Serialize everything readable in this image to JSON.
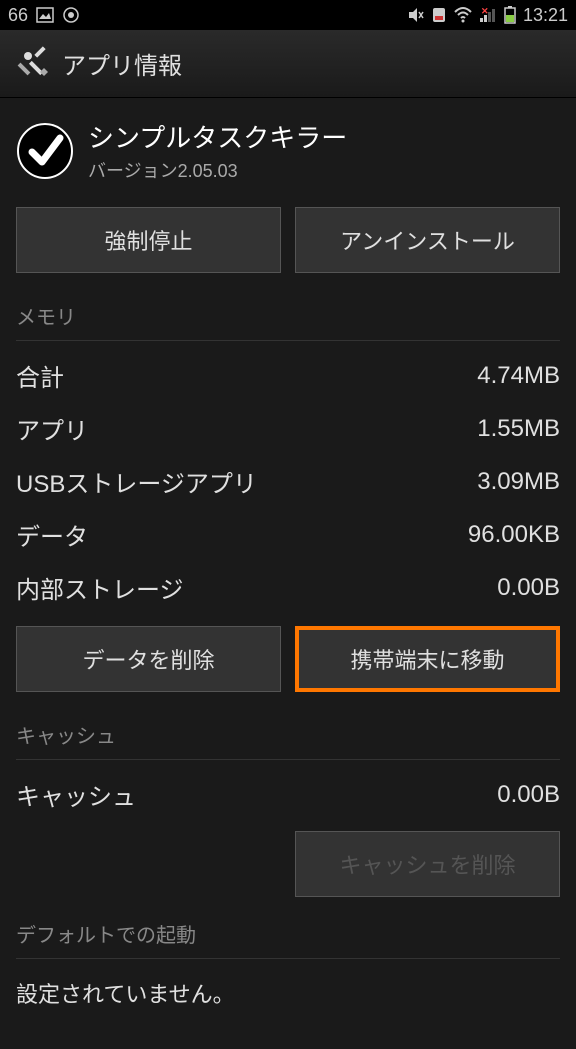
{
  "status_bar": {
    "left_number": "66",
    "time": "13:21"
  },
  "header": {
    "title": "アプリ情報"
  },
  "app": {
    "name": "シンプルタスクキラー",
    "version": "バージョン2.05.03"
  },
  "buttons": {
    "force_stop": "強制停止",
    "uninstall": "アンインストール",
    "clear_data": "データを削除",
    "move_to_phone": "携帯端末に移動",
    "clear_cache": "キャッシュを削除"
  },
  "sections": {
    "memory_title": "メモリ",
    "cache_title": "キャッシュ",
    "default_title": "デフォルトでの起動",
    "default_text": "設定されていません。"
  },
  "memory": {
    "total_label": "合計",
    "total_value": "4.74MB",
    "app_label": "アプリ",
    "app_value": "1.55MB",
    "usb_label": "USBストレージアプリ",
    "usb_value": "3.09MB",
    "data_label": "データ",
    "data_value": "96.00KB",
    "internal_label": "内部ストレージ",
    "internal_value": "0.00B"
  },
  "cache": {
    "cache_label": "キャッシュ",
    "cache_value": "0.00B"
  }
}
